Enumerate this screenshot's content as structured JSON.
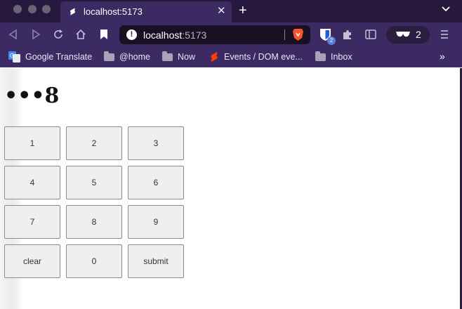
{
  "browser": {
    "tab": {
      "title": "localhost:5173",
      "close": "✕"
    },
    "new_tab": "+",
    "url": {
      "host": "localhost",
      "port": ":5173"
    },
    "extensions_badge": "2",
    "wallet_count": "2"
  },
  "bookmarks": [
    {
      "label": "Google Translate",
      "icon": "google-translate-icon"
    },
    {
      "label": "@home",
      "icon": "folder-icon"
    },
    {
      "label": "Now",
      "icon": "folder-icon"
    },
    {
      "label": "Events / DOM eve...",
      "icon": "svelte-icon"
    },
    {
      "label": "Inbox",
      "icon": "folder-icon"
    }
  ],
  "bookmarks_more": "»",
  "app": {
    "pin_display": "•••8",
    "keys": [
      "1",
      "2",
      "3",
      "4",
      "5",
      "6",
      "7",
      "8",
      "9",
      "clear",
      "0",
      "submit"
    ]
  },
  "colors": {
    "tab_strip": "#27193d",
    "toolbar": "#3c2a62",
    "key_background": "#efefef"
  }
}
